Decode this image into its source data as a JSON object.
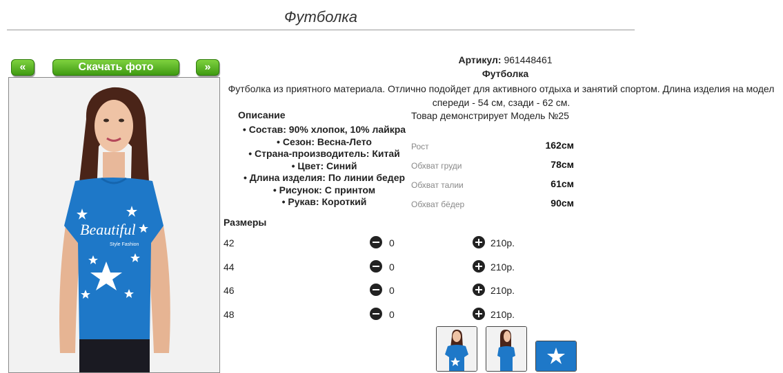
{
  "page": {
    "title": "Футболка"
  },
  "gallery": {
    "prev_label": "«",
    "download_label": "Скачать фото",
    "next_label": "»"
  },
  "product": {
    "article_label": "Артикул:",
    "article_value": "961448461",
    "name": "Футболка",
    "description_line1": "Футболка из приятного материала. Отлично подойдет для активного отдыха и занятий спортом. Длина изделия на модел",
    "description_line2": "спереди - 54 см, сзади - 62 см."
  },
  "specs": {
    "title": "Описание",
    "items": [
      "Состав: 90% хлопок, 10% лайкра",
      "Сезон: Весна-Лето",
      "Страна-производитель: Китай",
      "Цвет: Синий",
      "Длина изделия: По линии бедер",
      "Рисунок: С принтом",
      "Рукав: Короткий"
    ]
  },
  "model": {
    "title": "Товар демонстрирует Модель №25",
    "measurements": [
      {
        "label": "Рост",
        "value": "162см"
      },
      {
        "label": "Обхват груди",
        "value": "78см"
      },
      {
        "label": "Обхват талии",
        "value": "61см"
      },
      {
        "label": "Обхват бёдер",
        "value": "90см"
      }
    ]
  },
  "sizes": {
    "title": "Размеры",
    "rows": [
      {
        "size": "42",
        "qty": "0",
        "price": "210р."
      },
      {
        "size": "44",
        "qty": "0",
        "price": "210р."
      },
      {
        "size": "46",
        "qty": "0",
        "price": "210р."
      },
      {
        "size": "48",
        "qty": "0",
        "price": "210р."
      }
    ]
  },
  "colors": {
    "brand_green": "#4caf1c",
    "shirt_blue": "#1e78c8"
  },
  "icons": {
    "minus": "minus-circle-icon",
    "plus": "plus-circle-icon"
  }
}
